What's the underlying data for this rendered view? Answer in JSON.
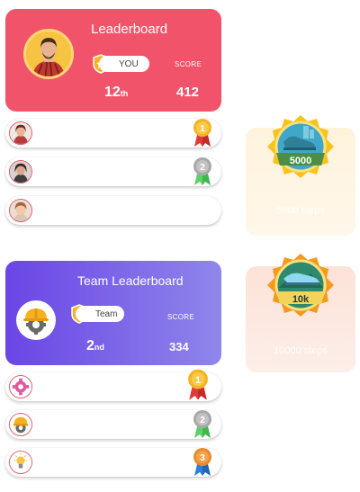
{
  "individual": {
    "title": "Leaderboard",
    "you_label": "YOU",
    "score_label": "SCORE",
    "rank_num": "12",
    "rank_suffix": "th",
    "score": "412"
  },
  "individual_rows": [
    {
      "avatar": "woman-avatar",
      "medal": "1"
    },
    {
      "avatar": "woman-avatar-2",
      "medal": "2"
    },
    {
      "avatar": "girl-avatar",
      "medal": ""
    }
  ],
  "team": {
    "title": "Team Leaderboard",
    "team_label": "Team",
    "score_label": "SCORE",
    "rank_num": "2",
    "rank_suffix": "nd",
    "score": "334"
  },
  "team_rows": [
    {
      "avatar": "gear-icon",
      "medal": "1"
    },
    {
      "avatar": "hardhat-icon",
      "medal": "2"
    },
    {
      "avatar": "lightbulb-icon",
      "medal": "3"
    }
  ],
  "badges": [
    {
      "value": "5000",
      "caption": "5000 steps"
    },
    {
      "value": "10k",
      "caption": "10000 steps"
    }
  ],
  "colors": {
    "individual_card": "#f1546a",
    "team_card_start": "#6a45e6",
    "team_card_end": "#8f86ea",
    "gold": "#f5b324",
    "silver": "#a8a8a8",
    "bronze": "#e98a2b"
  }
}
